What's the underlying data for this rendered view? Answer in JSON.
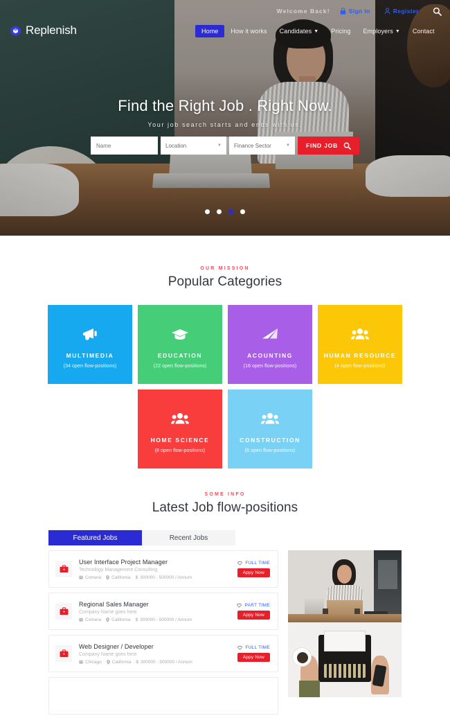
{
  "topbar": {
    "welcome": "Welcome Back!",
    "sign_in": "Sign In",
    "register": "Register",
    "search_icon": "search-icon",
    "lock_icon": "lock-icon",
    "user_icon": "user-icon"
  },
  "brand": {
    "name": "Replenish",
    "logo_icon": "hexagon-gem-icon",
    "logo_color": "#3b3bdd"
  },
  "nav": {
    "items": [
      {
        "label": "Home",
        "active": true,
        "caret": ""
      },
      {
        "label": "How it works",
        "active": false,
        "caret": ""
      },
      {
        "label": "Candidates",
        "active": false,
        "caret": "⌄"
      },
      {
        "label": "Pricing",
        "active": false,
        "caret": ""
      },
      {
        "label": "Employers",
        "active": false,
        "caret": "⌄"
      },
      {
        "label": "Contact",
        "active": false,
        "caret": ""
      }
    ]
  },
  "hero": {
    "title": "Find the Right Job . Right Now.",
    "subtitle": "Your job search starts and ends with us.",
    "search": {
      "name_placeholder": "Name",
      "name_value": "",
      "location_value": "Location",
      "sector_value": "Finance Sector",
      "button_label": "FIND JOB",
      "button_icon": "search-icon",
      "button_color": "#e61f2a"
    },
    "slider": {
      "total": 4,
      "active_index": 2
    }
  },
  "categories_section": {
    "eyebrow": "OUR MISSION",
    "title": "Popular Categories",
    "rows": [
      [
        {
          "name": "MULTIMEDIA",
          "count": "(34 open flow-positions)",
          "color": "#16a9f0",
          "icon": "megaphone-icon"
        },
        {
          "name": "EDUCATION",
          "count": "(22 open flow-positions)",
          "color": "#45ce77",
          "icon": "graduation-cap-icon"
        },
        {
          "name": "ACOUNTING",
          "count": "(16 open flow-positions)",
          "color": "#a95ee8",
          "icon": "paper-plane-icon"
        },
        {
          "name": "HUMAN RESOURCE",
          "count": "(4 open flow-positions)",
          "color": "#fbc707",
          "icon": "users-icon"
        }
      ],
      [
        {
          "name": "HOME SCIENCE",
          "count": "(8 open flow-positions)",
          "color": "#f93d3d",
          "icon": "users-icon"
        },
        {
          "name": "CONSTRUCTION",
          "count": "(6 open flow-positions)",
          "color": "#79d2f5",
          "icon": "users-icon"
        }
      ]
    ]
  },
  "jobs_section": {
    "eyebrow": "SOME INFO",
    "title": "Latest Job flow-positions",
    "tabs": [
      {
        "label": "Featured Jobs",
        "active": true
      },
      {
        "label": "Recent Jobs",
        "active": false
      }
    ],
    "jobs": [
      {
        "title": "User Interface Project Manager",
        "company_line": "Technology Management Consulting",
        "company": "Comera",
        "location": "California",
        "salary": "300000 - 500000 / Annum",
        "type": "FULL TIME",
        "apply_label": "Appy Now",
        "briefcase_icon": "briefcase-icon",
        "heart_icon": "heart-icon",
        "building_icon": "building-icon",
        "pin_icon": "map-pin-icon",
        "dollar_icon": "dollar-icon"
      },
      {
        "title": "Regional Sales Manager",
        "company_line": "Company Name goes here",
        "company": "Comera",
        "location": "California",
        "salary": "300000 - 500000 / Annum",
        "type": "PART TIME",
        "apply_label": "Appy Now",
        "briefcase_icon": "briefcase-icon",
        "heart_icon": "heart-icon",
        "building_icon": "building-icon",
        "pin_icon": "map-pin-icon",
        "dollar_icon": "dollar-icon"
      },
      {
        "title": "Web Designer / Developer",
        "company_line": "Company Name goes here",
        "company": "Chicago",
        "location": "California",
        "salary": "300000 - 500000 / Annum",
        "type": "FULL TIME",
        "apply_label": "Appy Now",
        "briefcase_icon": "briefcase-icon",
        "heart_icon": "heart-icon",
        "building_icon": "building-icon",
        "pin_icon": "map-pin-icon",
        "dollar_icon": "dollar-icon"
      }
    ],
    "side_images": [
      {
        "alt": "woman-at-desk-with-laptop-photo"
      },
      {
        "alt": "hands-typing-on-typewriter-photo"
      }
    ]
  }
}
